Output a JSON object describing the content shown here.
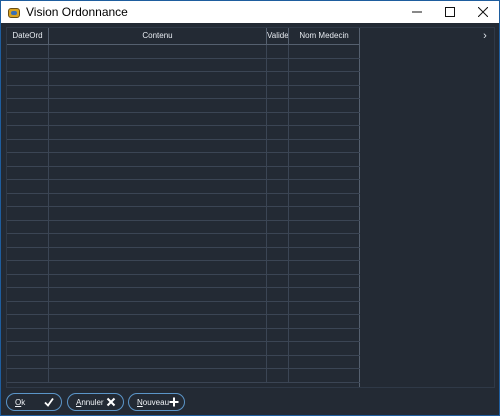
{
  "window": {
    "title": "Vision Ordonnance",
    "icon": "app-icon",
    "controls": [
      "minimize-icon",
      "maximize-icon",
      "close-icon"
    ]
  },
  "grid": {
    "columns": [
      "DateOrd",
      "Contenu",
      "Valide",
      "Nom Medecin"
    ],
    "rows": [],
    "scroll_right_glyph": "›"
  },
  "footer": {
    "ok": {
      "mnemonic": "O",
      "rest": "k",
      "icon": "check-icon"
    },
    "annuler": {
      "mnemonic": "A",
      "rest": "nnuler",
      "icon": "close-x-icon"
    },
    "nouveau": {
      "mnemonic": "N",
      "rest": "ouveau",
      "icon": "plus-icon"
    }
  },
  "colors": {
    "background": "#232a34",
    "grid_line": "#3b4554",
    "button_border": "#5b95c8",
    "text": "#e8ecf2"
  }
}
